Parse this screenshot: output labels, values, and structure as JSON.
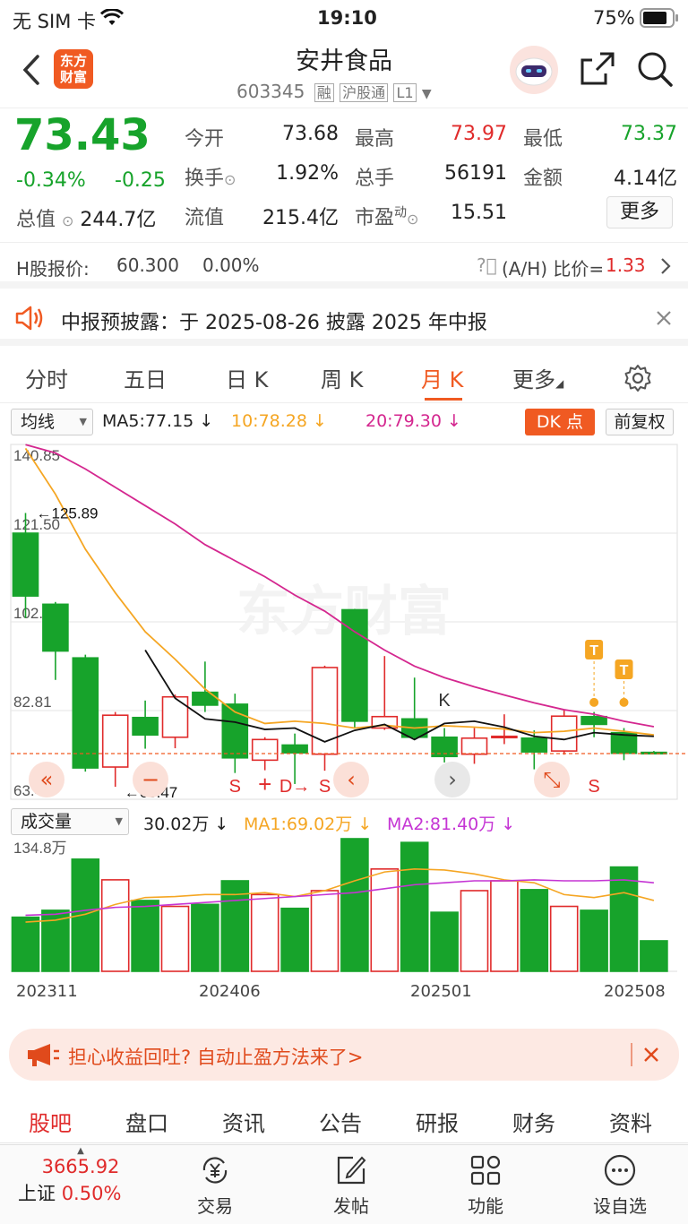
{
  "statusbar": {
    "carrier": "无 SIM 卡",
    "time": "19:10",
    "battery": "75%"
  },
  "header": {
    "logo_line1": "东方",
    "logo_line2": "财富",
    "title": "安井食品",
    "code": "603345",
    "badge_margin": "融",
    "badge_connect": "沪股通",
    "badge_level": "L1"
  },
  "quote": {
    "price": "73.43",
    "change_pct": "-0.34%",
    "change": "-0.25",
    "total_value_label": "总值",
    "total_value": "244.7亿",
    "rows": [
      [
        {
          "label": "今开",
          "value": "73.68"
        },
        {
          "label": "最高",
          "value": "73.97"
        },
        {
          "label": "最低",
          "value": "73.37"
        }
      ],
      [
        {
          "label": "换手",
          "value": "1.92%"
        },
        {
          "label": "总手",
          "value": "56191"
        },
        {
          "label": "金额",
          "value": "4.14亿"
        }
      ],
      [
        {
          "label": "流值",
          "value": "215.4亿"
        },
        {
          "label": "市盈",
          "sup": "动",
          "value": "15.51"
        }
      ]
    ],
    "more_label": "更多"
  },
  "hshare": {
    "label": "H股报价:",
    "price": "60.300",
    "pct": "0.00%",
    "ratio_label": "(A/H) 比价=",
    "ratio": "1.33"
  },
  "notice": {
    "text": "中报预披露：于 2025-08-26 披露 2025 年中报"
  },
  "tabs": [
    "分时",
    "五日",
    "日 K",
    "周 K",
    "月 K",
    "更多"
  ],
  "active_tab": "月 K",
  "ma_row": {
    "selector": "均线",
    "ma5": "MA5:77.15 ↓",
    "ma10": "10:78.28 ↓",
    "ma20": "20:79.30 ↓",
    "dk_label": "DK 点",
    "fq_label": "前复权"
  },
  "colors": {
    "up": "#e02b2b",
    "down": "#17a32b",
    "ma5": "#111111",
    "ma10": "#f5a623",
    "ma20": "#d4278f",
    "accent": "#f05a22"
  },
  "chart_data": [
    {
      "type": "candlestick",
      "y_tick_labels": [
        "140.85",
        "121.50",
        "102.16",
        "82.81",
        "63.47"
      ],
      "ylim": [
        63.47,
        140.85
      ],
      "max_marker": "←125.89",
      "min_marker": "←63.47",
      "candles": [
        {
          "o": 121.5,
          "c": 107.8,
          "h": 125.9,
          "l": 103.0
        },
        {
          "o": 106.0,
          "c": 95.8,
          "h": 106.5,
          "l": 89.5
        },
        {
          "o": 94.3,
          "c": 70.3,
          "h": 95.0,
          "l": 69.5
        },
        {
          "o": 70.5,
          "c": 81.8,
          "h": 82.5,
          "l": 66.2
        },
        {
          "o": 81.3,
          "c": 77.5,
          "h": 85.0,
          "l": 74.5
        },
        {
          "o": 77.0,
          "c": 85.8,
          "h": 86.3,
          "l": 74.6
        },
        {
          "o": 86.8,
          "c": 84.0,
          "h": 93.5,
          "l": 82.5
        },
        {
          "o": 84.2,
          "c": 72.5,
          "h": 86.5,
          "l": 69.2
        },
        {
          "o": 72.0,
          "c": 76.5,
          "h": 77.0,
          "l": 69.8
        },
        {
          "o": 75.3,
          "c": 73.6,
          "h": 77.8,
          "l": 66.8
        },
        {
          "o": 73.3,
          "c": 92.2,
          "h": 92.6,
          "l": 69.7
        },
        {
          "o": 104.8,
          "c": 80.5,
          "h": 105.0,
          "l": 79.0
        },
        {
          "o": 79.0,
          "c": 81.5,
          "h": 94.7,
          "l": 78.6
        },
        {
          "o": 81.0,
          "c": 77.0,
          "h": 90.0,
          "l": 76.5
        },
        {
          "o": 77.0,
          "c": 72.8,
          "h": 79.0,
          "l": 71.5
        },
        {
          "o": 73.3,
          "c": 76.8,
          "h": 79.0,
          "l": 71.2
        },
        {
          "o": 77.0,
          "c": 77.2,
          "h": 82.0,
          "l": 75.5
        },
        {
          "o": 76.8,
          "c": 73.8,
          "h": 78.5,
          "l": 70.0
        },
        {
          "o": 74.0,
          "c": 81.6,
          "h": 83.0,
          "l": 73.2
        },
        {
          "o": 81.5,
          "c": 79.8,
          "h": 82.5,
          "l": 77.0
        },
        {
          "o": 78.0,
          "c": 73.5,
          "h": 79.0,
          "l": 72.0
        },
        {
          "o": 73.7,
          "c": 73.4,
          "h": 74.0,
          "l": 73.4
        }
      ],
      "ma5": [
        null,
        null,
        null,
        null,
        96.0,
        85.5,
        81.0,
        80.3,
        78.7,
        79.0,
        76.0,
        78.5,
        79.8,
        76.5,
        80.0,
        80.5,
        79.2,
        77.2,
        76.5,
        78.0,
        77.5,
        77.2
      ],
      "ma10": [
        140.0,
        130.0,
        118.0,
        108.5,
        100.0,
        94.0,
        87.5,
        82.5,
        80.0,
        80.5,
        80.0,
        79.0,
        79.6,
        79.0,
        79.5,
        79.2,
        78.8,
        78.0,
        78.3,
        79.0,
        78.3,
        77.5
      ],
      "ma20": [
        140.8,
        139.0,
        135.5,
        131.5,
        127.5,
        123.5,
        119.0,
        115.5,
        112.0,
        108.0,
        104.5,
        100.0,
        96.0,
        92.5,
        90.0,
        88.0,
        86.2,
        84.5,
        83.0,
        82.0,
        80.5,
        79.3
      ],
      "signals": [
        {
          "i": 7,
          "label": "S"
        },
        {
          "i": 8,
          "label": "+"
        },
        {
          "i": 9,
          "label": "D→"
        },
        {
          "i": 10,
          "label": "S"
        },
        {
          "i": 14,
          "label": "S"
        },
        {
          "i": 19,
          "label": "S"
        },
        {
          "i": 14,
          "label": "K"
        }
      ],
      "t_markers": [
        19,
        20
      ],
      "current_price": 73.43
    },
    {
      "type": "bar",
      "y_tick_labels": [
        "134.8万"
      ],
      "ylim": [
        0,
        134.8
      ],
      "volumes": [
        55,
        62,
        114,
        93,
        72,
        66,
        68,
        92,
        78,
        64,
        82,
        134.8,
        104,
        131,
        60,
        82,
        92,
        83,
        66,
        62,
        106,
        31
      ],
      "ma1": [
        50,
        52,
        58,
        68,
        75,
        76,
        78,
        78,
        80,
        76,
        82,
        92,
        101,
        104,
        103,
        99,
        93,
        90,
        78,
        75,
        80,
        72
      ],
      "ma2": [
        57,
        58,
        62,
        65,
        66,
        68,
        70,
        72,
        74,
        76,
        78,
        80,
        84,
        88,
        90,
        92,
        92,
        93,
        92,
        92,
        93,
        90
      ],
      "x_tick_labels": [
        "202311",
        "202406",
        "202501",
        "202508"
      ]
    }
  ],
  "vol_row": {
    "selector": "成交量",
    "vol": "30.02万 ↓",
    "ma1": "MA1:69.02万 ↓",
    "ma2": "MA2:81.40万 ↓"
  },
  "banner": {
    "text": "担心收益回吐? 自动止盈方法来了>"
  },
  "subtabs": [
    "股吧",
    "盘口",
    "资讯",
    "公告",
    "研报",
    "财务",
    "资料"
  ],
  "bottombar": {
    "index_value": "3665.92",
    "index_name": "上证",
    "index_pct": "0.50%",
    "items": [
      "交易",
      "发帖",
      "功能",
      "设自选"
    ]
  }
}
